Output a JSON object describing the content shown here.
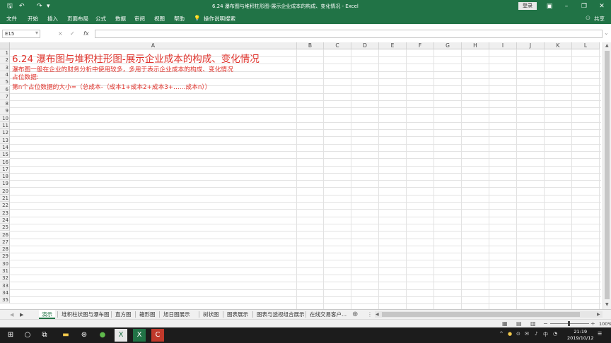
{
  "window": {
    "title": "6.24 瀑布图与堆积柱形图-展示企业成本的构成、变化情况 - Excel",
    "signin_label": "登录"
  },
  "icons": {
    "save": "save-icon",
    "undo": "undo-icon",
    "redo": "redo-icon",
    "customize": "customize-qat-icon",
    "ribbon_display": "ribbon-display-icon",
    "minimize": "minimize-icon",
    "restore": "restore-icon",
    "close": "close-icon",
    "lightbulb": "lightbulb-icon",
    "share": "share-icon"
  },
  "ribbon": {
    "tabs": [
      "文件",
      "开始",
      "插入",
      "页面布局",
      "公式",
      "数据",
      "审阅",
      "视图",
      "帮助"
    ],
    "tell_me": "操作说明搜索",
    "share": "共享"
  },
  "formula_bar": {
    "name_box": "E15",
    "fx": "fx",
    "cancel": "×",
    "enter": "✓",
    "value": ""
  },
  "columns": [
    "A",
    "B",
    "C",
    "D",
    "E",
    "F",
    "G",
    "H",
    "I",
    "J",
    "K",
    "L"
  ],
  "rows": [
    "1",
    "2",
    "3",
    "4",
    "5",
    "6",
    "7",
    "8",
    "9",
    "10",
    "11",
    "12",
    "13",
    "14",
    "15",
    "16",
    "17",
    "18",
    "19",
    "20",
    "21",
    "22",
    "23",
    "24",
    "25",
    "26",
    "27",
    "28",
    "29",
    "30",
    "31",
    "32",
    "33",
    "34",
    "35"
  ],
  "cells": {
    "A1": "6.24 瀑布图与堆积柱形图-展示企业成本的构成、变化情况",
    "A2": "瀑布图一般在企业的财务分析中使用较多，多用于表示企业成本的构成、变化情况",
    "A3": "占位数据:",
    "A4": "第n个占位数据的大小=（总成本-（成本1+成本2+成本3+……成本n））"
  },
  "sheet_tabs": [
    "演示",
    "堆积柱状图与瀑布图",
    "直方图",
    "箱形图",
    "旭日图展示",
    "树状图",
    "图表展示",
    "图表与透视组合展示",
    "在线交易客户..."
  ],
  "status": {
    "zoom": "100%"
  },
  "colors": {
    "excel_green": "#217346",
    "cell_text": "#e0322b"
  },
  "taskbar": {
    "time": "21:19",
    "date": "2019/10/12",
    "ime": "中"
  }
}
